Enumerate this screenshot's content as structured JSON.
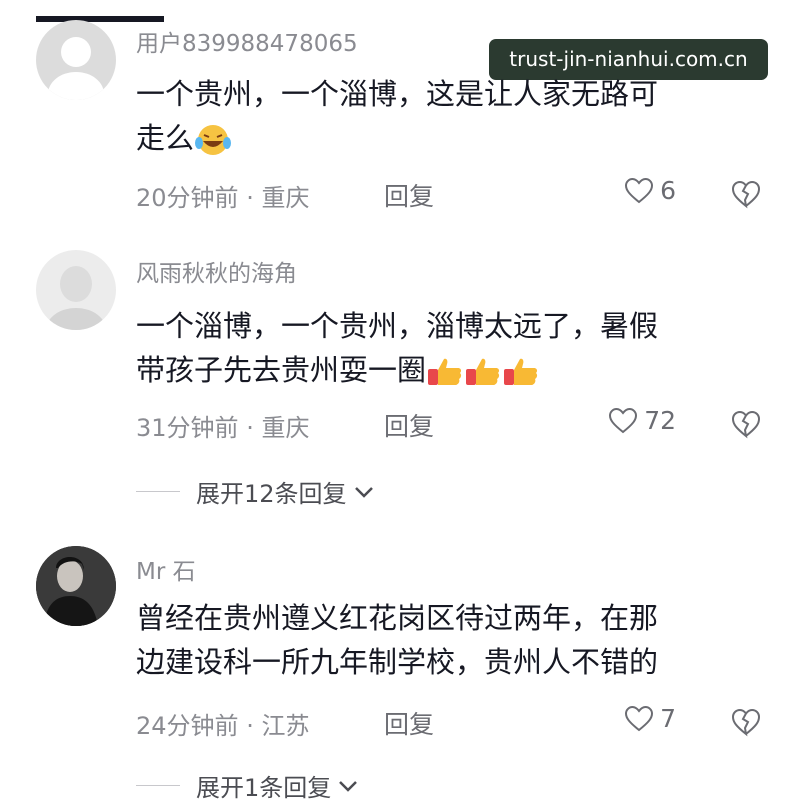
{
  "watermark": "trust-jin-nianhui.com.cn",
  "comments": [
    {
      "username": "用户8399884780​65",
      "text_line1": "一个贵州，一个淄博，这是让人家无路可",
      "text_line2": "走么",
      "emoji": "laugh-cry-emoji",
      "time": "20分钟前",
      "location": "重庆",
      "reply_label": "回复",
      "likes": "6"
    },
    {
      "username": "风雨秋秋的海角",
      "text_line1": "一个淄博，一个贵州，淄博太远了，暑假",
      "text_line2": "带孩子先去贵州耍一圈",
      "emoji": "thumbs-up-emoji",
      "time": "31分钟前",
      "location": "重庆",
      "reply_label": "回复",
      "likes": "72",
      "expand_label": "展开12条回复"
    },
    {
      "username": "Mr 石",
      "text_line1": "曾经在贵州遵义红花岗区待过两年，在那",
      "text_line2": "边建设科一所九年制学校，贵州人不错的",
      "time": "24分钟前",
      "location": "江苏",
      "reply_label": "回复",
      "likes": "7",
      "expand_label": "展开1条回复"
    }
  ],
  "separator": "·"
}
